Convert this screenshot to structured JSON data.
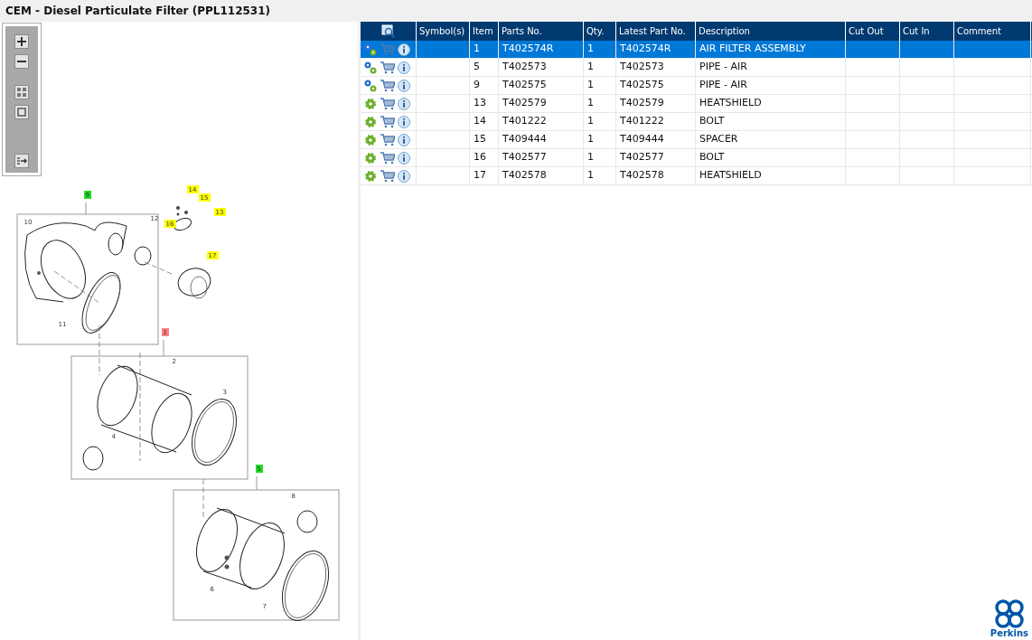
{
  "title": "CEM - Diesel Particulate Filter (PPL112531)",
  "callouts": [
    {
      "label": "9",
      "kind": "green"
    },
    {
      "label": "10",
      "kind": "plain"
    },
    {
      "label": "12",
      "kind": "plain"
    },
    {
      "label": "14",
      "kind": "yellow"
    },
    {
      "label": "15",
      "kind": "yellow"
    },
    {
      "label": "16",
      "kind": "yellow"
    },
    {
      "label": "13",
      "kind": "yellow"
    },
    {
      "label": "17",
      "kind": "yellow"
    },
    {
      "label": "11",
      "kind": "plain"
    },
    {
      "label": "1",
      "kind": "red"
    },
    {
      "label": "2",
      "kind": "plain"
    },
    {
      "label": "3",
      "kind": "plain"
    },
    {
      "label": "4",
      "kind": "plain"
    },
    {
      "label": "5",
      "kind": "green"
    },
    {
      "label": "8",
      "kind": "plain"
    },
    {
      "label": "6",
      "kind": "plain"
    },
    {
      "label": "7",
      "kind": "plain"
    }
  ],
  "table": {
    "columns": [
      "Symbol(s)",
      "Item",
      "Parts No.",
      "Qty.",
      "Latest Part No.",
      "Description",
      "Cut Out",
      "Cut In",
      "Comment"
    ],
    "rows": [
      {
        "kind": "assembly",
        "selected": true,
        "cells": [
          "",
          "1",
          "T402574R",
          "1",
          "T402574R",
          "AIR FILTER ASSEMBLY",
          "",
          "",
          ""
        ]
      },
      {
        "kind": "assembly",
        "selected": false,
        "cells": [
          "",
          "5",
          "T402573",
          "1",
          "T402573",
          "PIPE - AIR",
          "",
          "",
          ""
        ]
      },
      {
        "kind": "assembly",
        "selected": false,
        "cells": [
          "",
          "9",
          "T402575",
          "1",
          "T402575",
          "PIPE - AIR",
          "",
          "",
          ""
        ]
      },
      {
        "kind": "part",
        "selected": false,
        "cells": [
          "",
          "13",
          "T402579",
          "1",
          "T402579",
          "HEATSHIELD",
          "",
          "",
          ""
        ]
      },
      {
        "kind": "part",
        "selected": false,
        "cells": [
          "",
          "14",
          "T401222",
          "1",
          "T401222",
          "BOLT",
          "",
          "",
          ""
        ]
      },
      {
        "kind": "part",
        "selected": false,
        "cells": [
          "",
          "15",
          "T409444",
          "1",
          "T409444",
          "SPACER",
          "",
          "",
          ""
        ]
      },
      {
        "kind": "part",
        "selected": false,
        "cells": [
          "",
          "16",
          "T402577",
          "1",
          "T402577",
          "BOLT",
          "",
          "",
          ""
        ]
      },
      {
        "kind": "part",
        "selected": false,
        "cells": [
          "",
          "17",
          "T402578",
          "1",
          "T402578",
          "HEATSHIELD",
          "",
          "",
          ""
        ]
      }
    ]
  },
  "logo_text": "Perkins"
}
